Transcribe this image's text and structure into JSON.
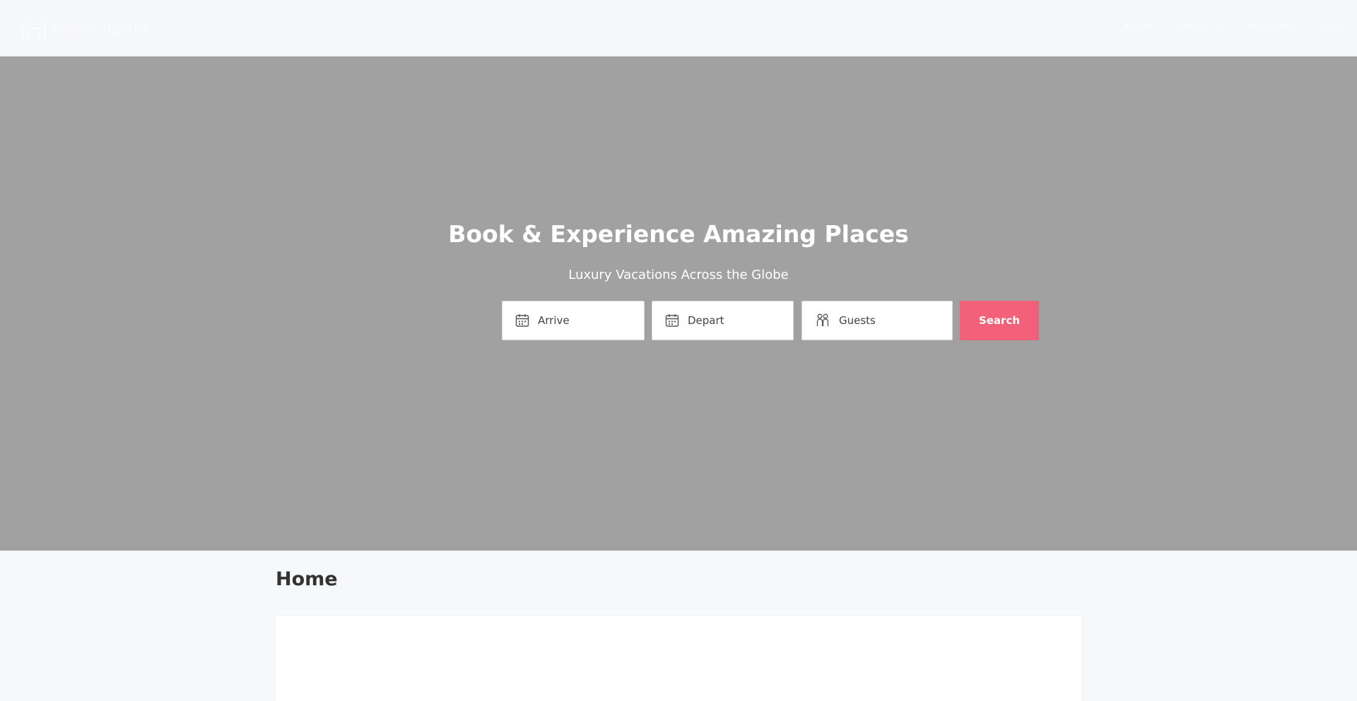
{
  "header": {
    "logo_text": "DIMMA HOMES",
    "nav": [
      "Home",
      "About Us",
      "About Me",
      "Login"
    ]
  },
  "hero": {
    "title": "Book & Experience Amazing Places",
    "subtitle": "Luxury Vacations Across the Globe"
  },
  "search": {
    "arrive_placeholder": "Arrive",
    "depart_placeholder": "Depart",
    "guests_placeholder": "Guests",
    "button_label": "Search"
  },
  "main": {
    "heading": "Home"
  },
  "colors": {
    "hero_background": "#a1a1a1",
    "accent": "#f26079",
    "page_background": "#f7f8fa"
  }
}
